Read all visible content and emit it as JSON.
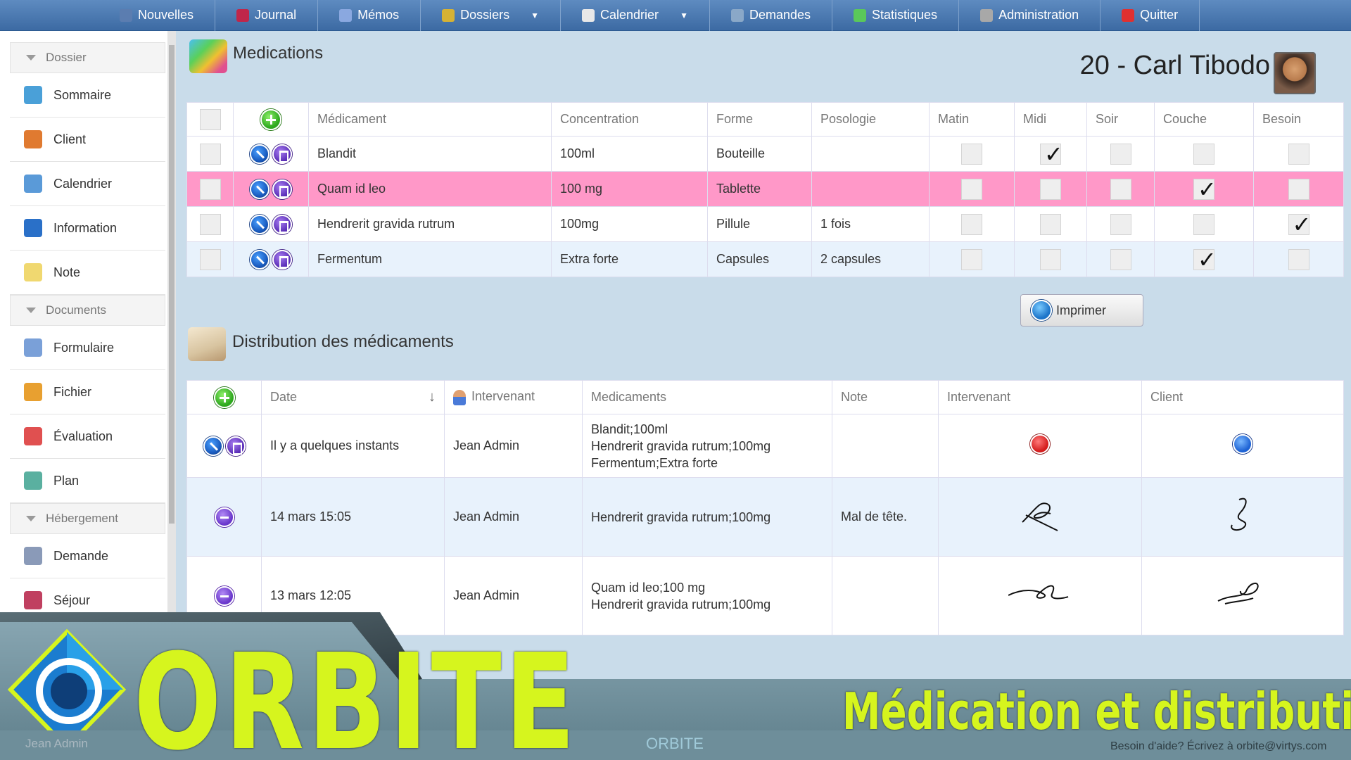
{
  "nav": {
    "items": [
      {
        "label": "Nouvelles",
        "icon": "news-icon",
        "color": "#5b7db0"
      },
      {
        "label": "Journal",
        "icon": "journal-icon",
        "color": "#c0264a"
      },
      {
        "label": "Mémos",
        "icon": "memo-icon",
        "color": "#8aa8e0"
      },
      {
        "label": "Dossiers",
        "icon": "folders-icon",
        "color": "#d6b234",
        "dropdown": true
      },
      {
        "label": "Calendrier",
        "icon": "calendar-icon",
        "color": "#e8e8e8",
        "dropdown": true
      },
      {
        "label": "Demandes",
        "icon": "requests-icon",
        "color": "#8aa8c8"
      },
      {
        "label": "Statistiques",
        "icon": "stats-icon",
        "color": "#5ac85a"
      },
      {
        "label": "Administration",
        "icon": "admin-icon",
        "color": "#a8a8a8"
      },
      {
        "label": "Quitter",
        "icon": "quit-icon",
        "color": "#e03030"
      }
    ]
  },
  "sidebar": {
    "sections": [
      {
        "title": "Dossier",
        "items": [
          {
            "label": "Sommaire",
            "icon": "puzzle-icon",
            "color": "#4aa0d8"
          },
          {
            "label": "Client",
            "icon": "person-icon",
            "color": "#e07a30"
          },
          {
            "label": "Calendrier",
            "icon": "calendar-icon",
            "color": "#5a9ad8"
          },
          {
            "label": "Information",
            "icon": "org-chart-icon",
            "color": "#2a70c8"
          },
          {
            "label": "Note",
            "icon": "note-icon",
            "color": "#f0d870"
          }
        ]
      },
      {
        "title": "Documents",
        "items": [
          {
            "label": "Formulaire",
            "icon": "form-icon",
            "color": "#7aa0d8"
          },
          {
            "label": "Fichier",
            "icon": "file-icon",
            "color": "#e8a030"
          },
          {
            "label": "Évaluation",
            "icon": "checklist-icon",
            "color": "#e05050"
          },
          {
            "label": "Plan",
            "icon": "plan-icon",
            "color": "#5ab0a0"
          }
        ]
      },
      {
        "title": "Hébergement",
        "items": [
          {
            "label": "Demande",
            "icon": "request-icon",
            "color": "#8a9ab8"
          },
          {
            "label": "Séjour",
            "icon": "stay-icon",
            "color": "#c04060"
          }
        ]
      }
    ]
  },
  "medications": {
    "title": "Medications",
    "patient": "20 - Carl Tibodo",
    "columns": [
      "Médicament",
      "Concentration",
      "Forme",
      "Posologie",
      "Matin",
      "Midi",
      "Soir",
      "Couche",
      "Besoin"
    ],
    "rows": [
      {
        "name": "Blandit",
        "concentration": "100ml",
        "forme": "Bouteille",
        "posologie": "",
        "matin": false,
        "midi": true,
        "soir": false,
        "couche": false,
        "besoin": false,
        "highlight": "#ffffff"
      },
      {
        "name": "Quam id leo",
        "concentration": "100 mg",
        "forme": "Tablette",
        "posologie": "",
        "matin": false,
        "midi": false,
        "soir": false,
        "couche": true,
        "besoin": false,
        "highlight": "#ff98c8"
      },
      {
        "name": "Hendrerit gravida rutrum",
        "concentration": "100mg",
        "forme": "Pillule",
        "posologie": "1 fois",
        "matin": false,
        "midi": false,
        "soir": false,
        "couche": false,
        "besoin": true,
        "highlight": "#ffffff"
      },
      {
        "name": "Fermentum",
        "concentration": "Extra forte",
        "forme": "Capsules",
        "posologie": "2 capsules",
        "matin": false,
        "midi": false,
        "soir": false,
        "couche": true,
        "besoin": false,
        "highlight": "#e8f2fc"
      }
    ]
  },
  "distribution": {
    "title": "Distribution des médicaments",
    "print_label": "Imprimer",
    "columns": [
      "Date",
      "Intervenant",
      "Medicaments",
      "Note",
      "Intervenant",
      "Client"
    ],
    "rows": [
      {
        "date": "Il y a quelques instants",
        "intervenant": "Jean Admin",
        "medicaments": "Blandit;100ml\nHendrerit gravida rutrum;100mg\nFermentum;Extra forte",
        "note": "",
        "sig_interv": "red-pin",
        "sig_client": "blue-pin",
        "mode": "edit"
      },
      {
        "date": "14 mars 15:05",
        "intervenant": "Jean Admin",
        "medicaments": "Hendrerit gravida rutrum;100mg",
        "note": "Mal de tête.",
        "sig_interv": "signature",
        "sig_client": "signature",
        "mode": "minus"
      },
      {
        "date": "13 mars 12:05",
        "intervenant": "Jean Admin",
        "medicaments": "Quam id leo;100 mg\nHendrerit gravida rutrum;100mg",
        "note": "",
        "sig_interv": "signature",
        "sig_client": "signature",
        "mode": "minus"
      }
    ]
  },
  "banner": {
    "logo": "ORBITE",
    "subtitle": "Médication et distribution",
    "footer_user": "Jean Admin",
    "footer_logo": "ORBITE",
    "footer_help": "Besoin d'aide? Écrivez à orbite@virtys.com",
    "accent": "#d6f51e"
  }
}
